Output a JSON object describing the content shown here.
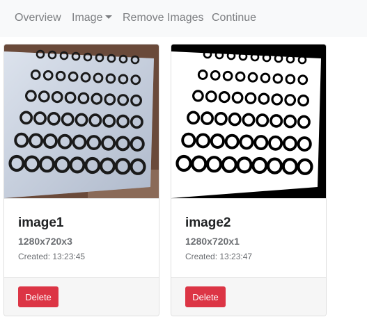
{
  "nav": {
    "overview": "Overview",
    "image": "Image",
    "remove_images": "Remove Images",
    "continue": "Continue"
  },
  "cards": [
    {
      "title": "image1",
      "resolution": "1280x720x3",
      "created": "Created: 13:23:45",
      "delete_label": "Delete"
    },
    {
      "title": "image2",
      "resolution": "1280x720x1",
      "created": "Created: 13:23:47",
      "delete_label": "Delete"
    }
  ],
  "colors": {
    "navbar_bg": "#f8f9fa",
    "delete_button": "#dc3545"
  }
}
